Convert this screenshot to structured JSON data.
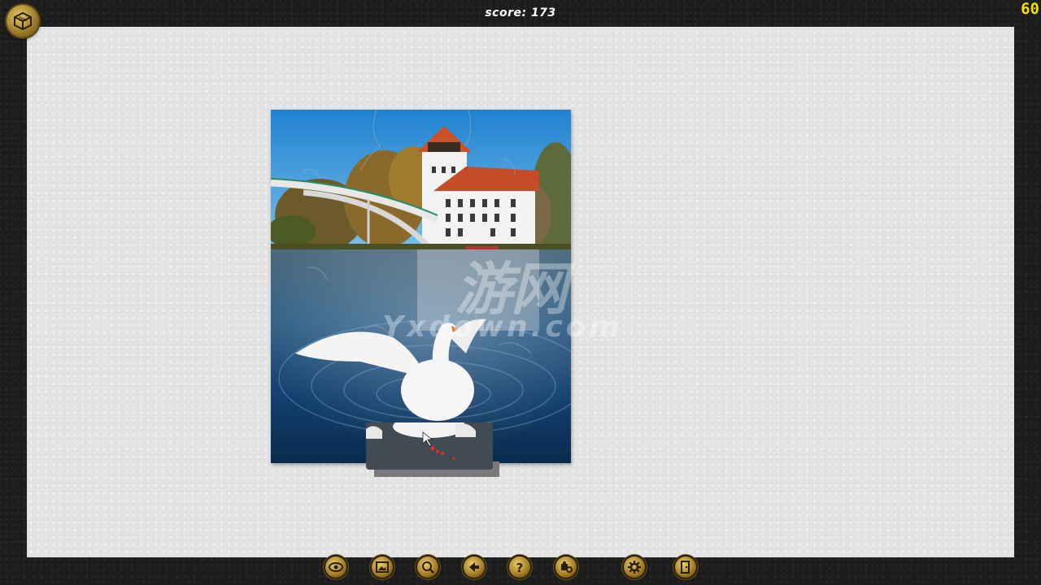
{
  "hud": {
    "score_label": "score:",
    "score_value": "173",
    "fps": "60"
  },
  "watermark": {
    "top": "游网",
    "bottom": "Yxdown.com"
  },
  "toolbar": {
    "buttons": [
      {
        "name": "preview",
        "icon": "eye-icon"
      },
      {
        "name": "background",
        "icon": "picture-icon"
      },
      {
        "name": "zoom",
        "icon": "magnifier-icon"
      },
      {
        "name": "undo",
        "icon": "left-arrow-icon"
      },
      {
        "name": "hint",
        "icon": "question-icon"
      },
      {
        "name": "sort-pieces",
        "icon": "puzzle-gear-icon"
      },
      {
        "name": "settings",
        "icon": "gear-icon"
      },
      {
        "name": "exit",
        "icon": "exit-door-icon"
      }
    ]
  },
  "colors": {
    "frame": "#1c1c1c",
    "board": "#e4e4e4",
    "button_gold": "#c9a23a",
    "fps": "#f5e000"
  }
}
